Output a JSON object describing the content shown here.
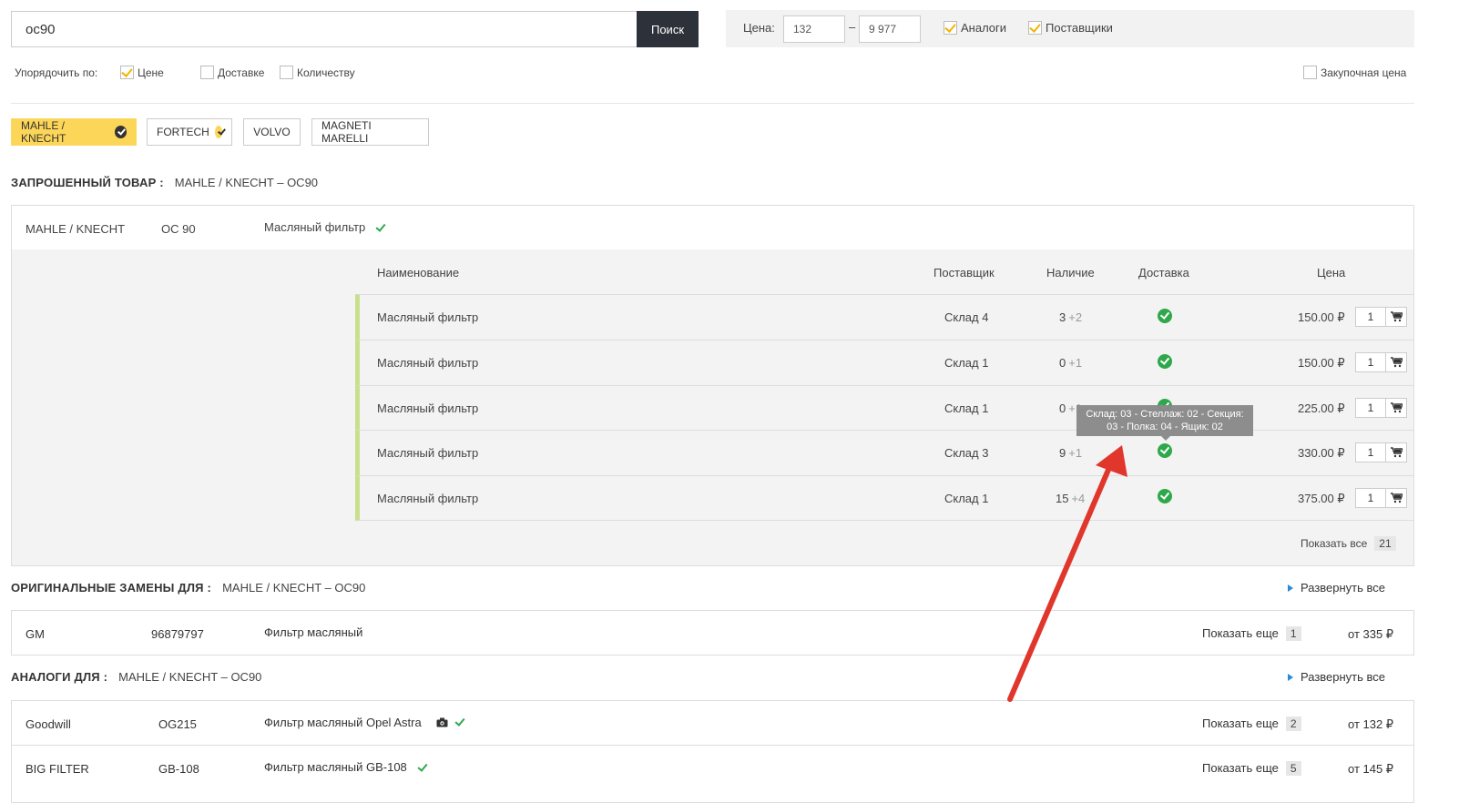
{
  "search": {
    "value": "oc90",
    "button": "Поиск"
  },
  "filter": {
    "price_label": "Цена:",
    "price_from": "132",
    "price_dash": "–",
    "price_to": "9 977",
    "analogs": "Аналоги",
    "suppliers": "Поставщики",
    "purchase_price": "Закупочная цена"
  },
  "sort": {
    "label": "Упорядочить по:",
    "price": "Цене",
    "delivery": "Доставке",
    "quantity": "Количеству"
  },
  "brands": [
    "MAHLE / KNECHT",
    "FORTECH",
    "VOLVO",
    "MAGNETI MARELLI"
  ],
  "requested": {
    "title": "ЗАПРОШЕННЫЙ ТОВАР :",
    "sub": "MAHLE / KNECHT – OC90",
    "brand": "MAHLE / KNECHT",
    "code": "OC 90",
    "name": "Масляный фильтр",
    "headers": {
      "name": "Наименование",
      "supplier": "Поставщик",
      "avail": "Наличие",
      "delivery": "Доставка",
      "price": "Цена"
    },
    "rows": [
      {
        "name": "Масляный фильтр",
        "supplier": "Склад 4",
        "avail": "3",
        "avail_plus": "+2",
        "price": "150.00 ₽",
        "qty": "1"
      },
      {
        "name": "Масляный фильтр",
        "supplier": "Склад 1",
        "avail": "0",
        "avail_plus": "+1",
        "price": "150.00 ₽",
        "qty": "1"
      },
      {
        "name": "Масляный фильтр",
        "supplier": "Склад 1",
        "avail": "0",
        "avail_plus": "+1",
        "price": "225.00 ₽",
        "qty": "1"
      },
      {
        "name": "Масляный фильтр",
        "supplier": "Склад 3",
        "avail": "9",
        "avail_plus": "+1",
        "price": "330.00 ₽",
        "qty": "1"
      },
      {
        "name": "Масляный фильтр",
        "supplier": "Склад 1",
        "avail": "15",
        "avail_plus": "+4",
        "price": "375.00 ₽",
        "qty": "1"
      }
    ],
    "show_all": "Показать все",
    "show_all_count": "21",
    "tooltip_line1": "Склад: 03 - Стеллаж: 02 - Секция:",
    "tooltip_line2": "03 - Полка: 04 - Ящик: 02"
  },
  "originals": {
    "title": "ОРИГИНАЛЬНЫЕ ЗАМЕНЫ ДЛЯ :",
    "sub": "MAHLE / KNECHT – OC90",
    "expand": "Развернуть все",
    "items": [
      {
        "brand": "GM",
        "code": "96879797",
        "name": "Фильтр масляный",
        "more": "Показать еще",
        "more_count": "1",
        "price": "от 335 ₽"
      }
    ]
  },
  "analogs": {
    "title": "АНАЛОГИ ДЛЯ :",
    "sub": "MAHLE / KNECHT – OC90",
    "expand": "Развернуть все",
    "items": [
      {
        "brand": "Goodwill",
        "code": "OG215",
        "name": "Фильтр масляный Opel Astra",
        "more": "Показать еще",
        "more_count": "2",
        "price": "от 132 ₽"
      },
      {
        "brand": "BIG FILTER",
        "code": "GB-108",
        "name": "Фильтр масляный GB-108",
        "more": "Показать еще",
        "more_count": "5",
        "price": "от 145 ₽"
      }
    ]
  },
  "colors": {
    "accent": "#fcd658",
    "dark": "#2d323a",
    "ok": "#2ea84a",
    "arrow": "#e0362c",
    "row_marker": "#c8e08c"
  }
}
